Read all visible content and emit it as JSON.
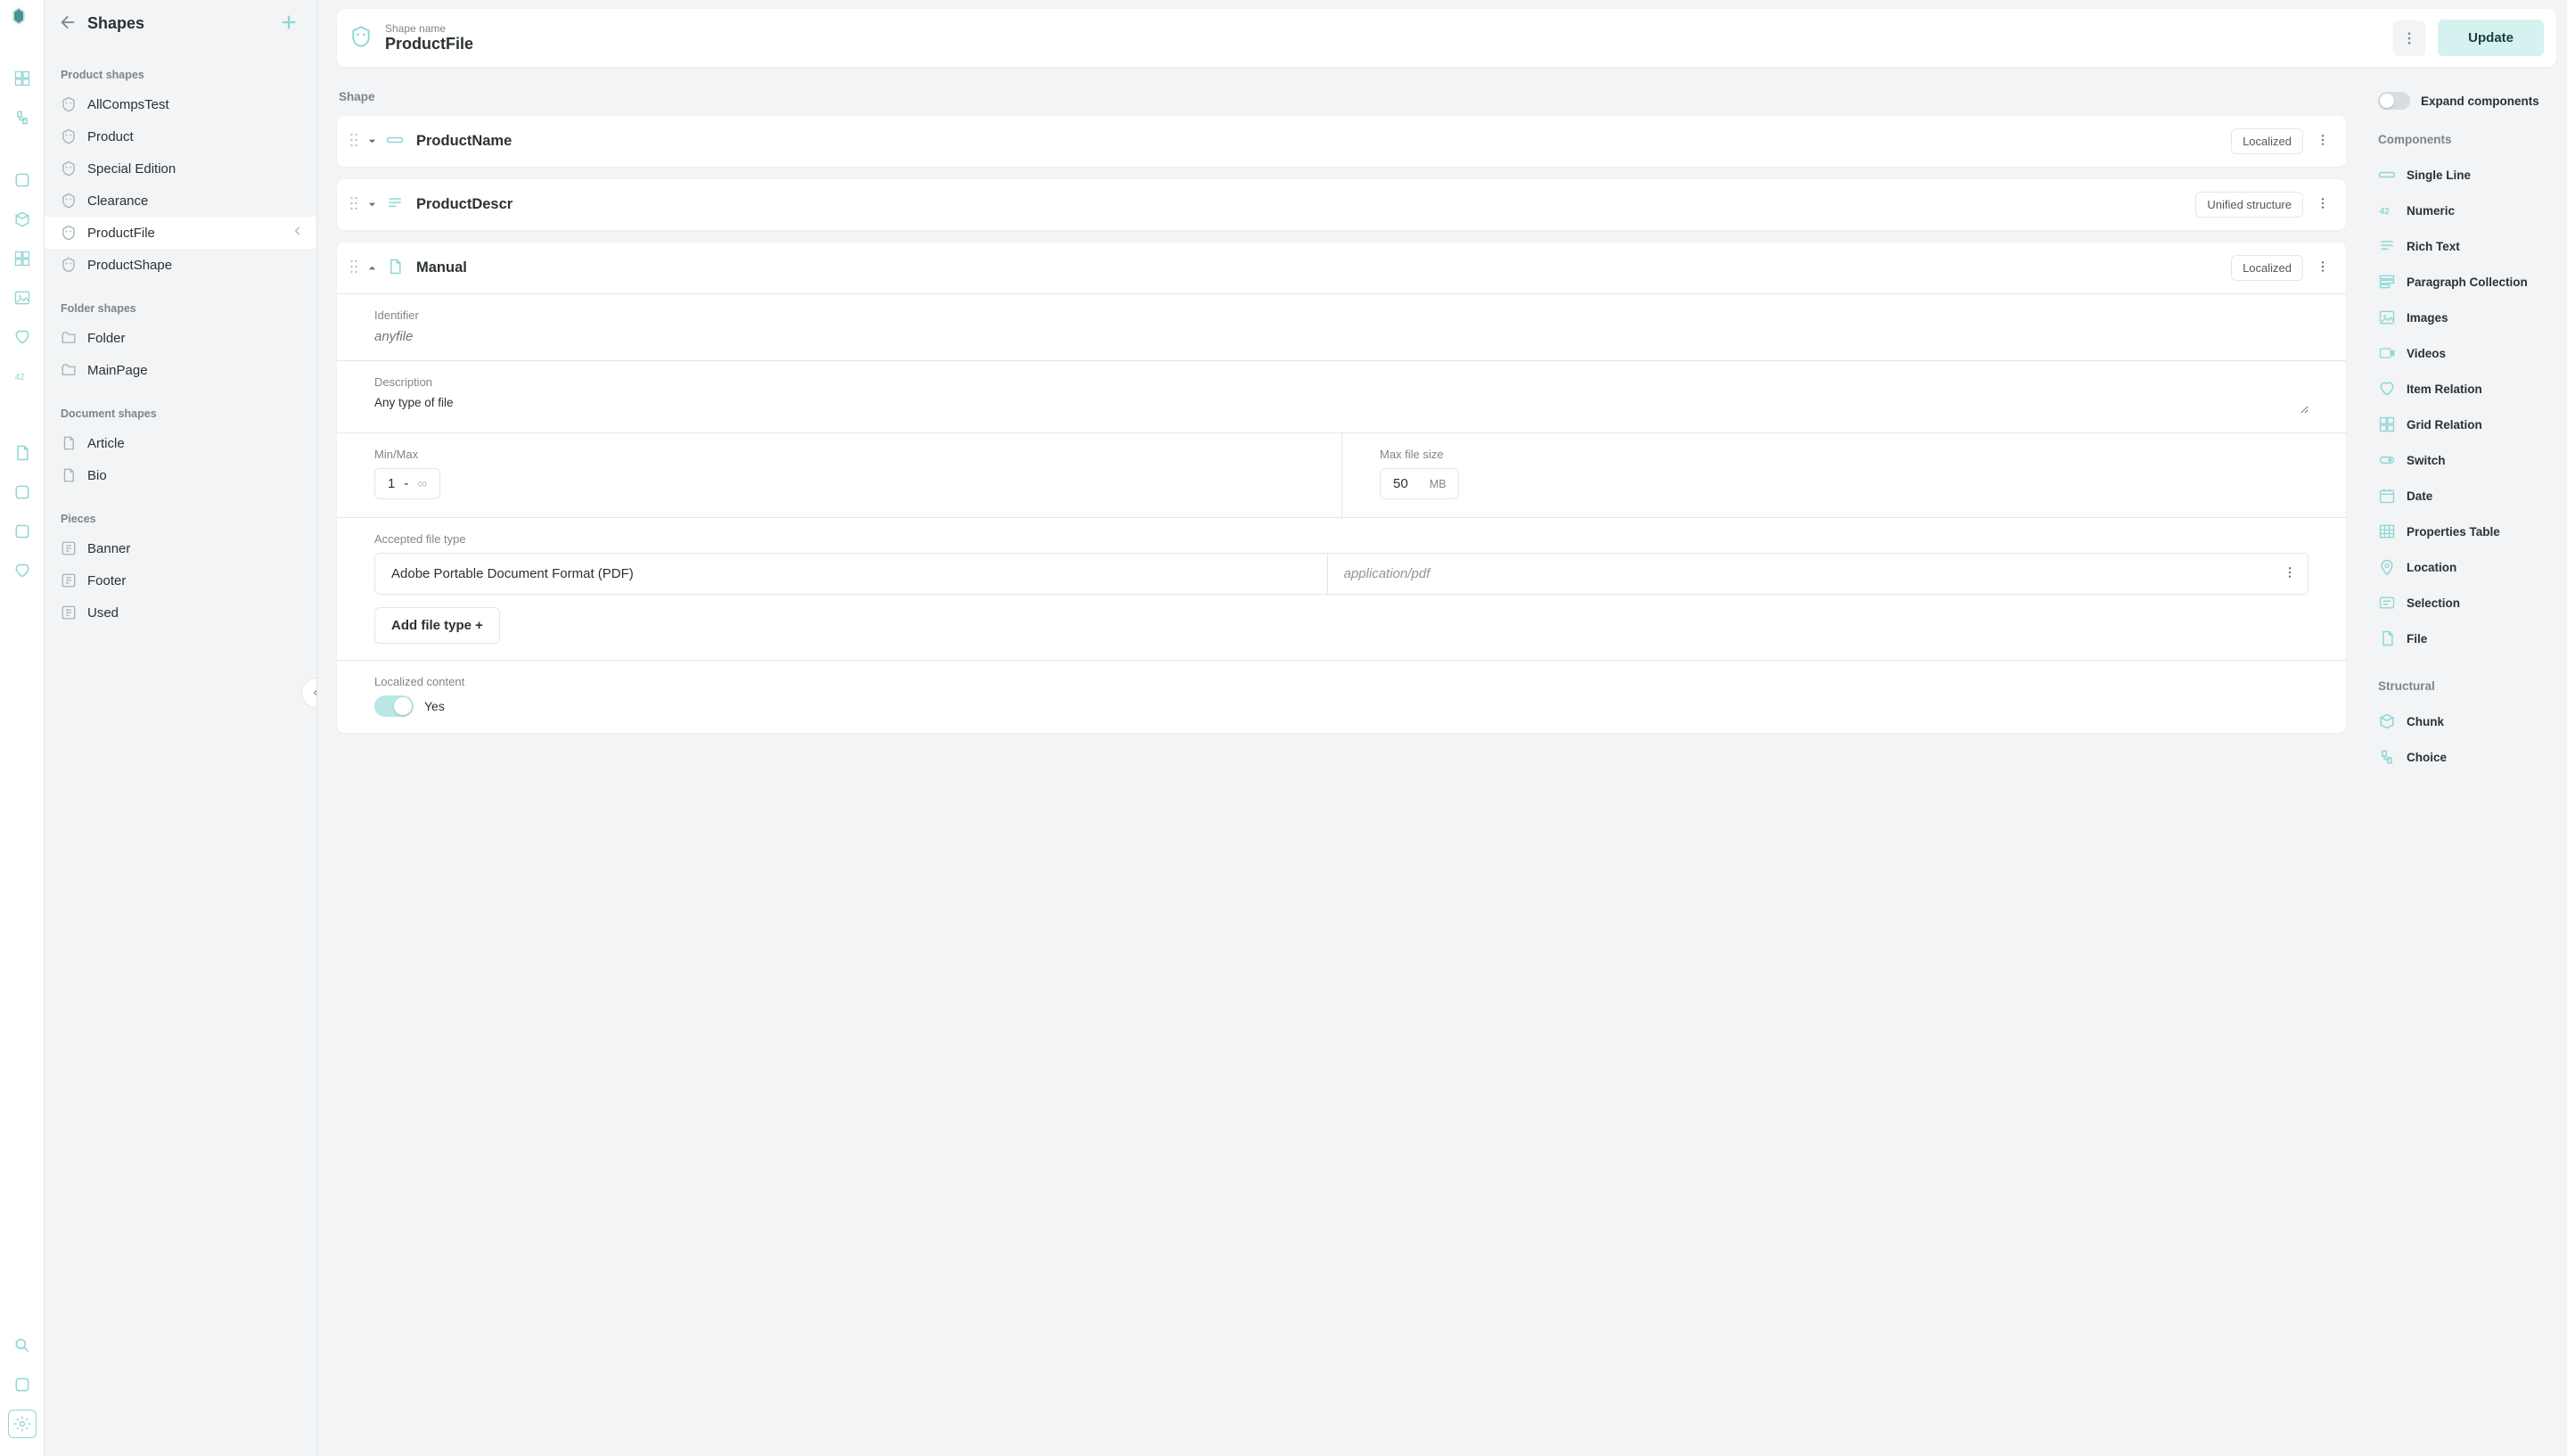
{
  "sidebar": {
    "title": "Shapes",
    "groups": [
      {
        "title": "Product shapes",
        "items": [
          {
            "label": "AllCompsTest",
            "active": false
          },
          {
            "label": "Product",
            "active": false
          },
          {
            "label": "Special Edition",
            "active": false
          },
          {
            "label": "Clearance",
            "active": false
          },
          {
            "label": "ProductFile",
            "active": true
          },
          {
            "label": "ProductShape",
            "active": false
          }
        ]
      },
      {
        "title": "Folder shapes",
        "items": [
          {
            "label": "Folder"
          },
          {
            "label": "MainPage"
          }
        ]
      },
      {
        "title": "Document shapes",
        "items": [
          {
            "label": "Article"
          },
          {
            "label": "Bio"
          }
        ]
      },
      {
        "title": "Pieces",
        "items": [
          {
            "label": "Banner"
          },
          {
            "label": "Footer"
          },
          {
            "label": "Used"
          }
        ]
      }
    ]
  },
  "header": {
    "label": "Shape name",
    "value": "ProductFile",
    "update_label": "Update"
  },
  "editor": {
    "section_label": "Shape",
    "components": [
      {
        "name": "ProductName",
        "tag": "Localized",
        "expanded": false,
        "type": "single-line"
      },
      {
        "name": "ProductDescr",
        "tag": "Unified structure",
        "expanded": false,
        "type": "rich-text"
      },
      {
        "name": "Manual",
        "tag": "Localized",
        "expanded": true,
        "type": "file",
        "identifier_label": "Identifier",
        "identifier": "anyfile",
        "description_label": "Description",
        "description": "Any type of file",
        "minmax_label": "Min/Max",
        "min": "1",
        "dash": "-",
        "max_placeholder": "∞",
        "maxfs_label": "Max file size",
        "maxfs": "50",
        "maxfs_unit": "MB",
        "aft_label": "Accepted file type",
        "ft_name": "Adobe Portable Document Format (PDF)",
        "ft_mime": "application/pdf",
        "add_ft_label": "Add file type +",
        "loc_label": "Localized content",
        "loc_value": "Yes"
      }
    ]
  },
  "inspector": {
    "expand_label": "Expand components",
    "sections": [
      {
        "title": "Components",
        "items": [
          "Single Line",
          "Numeric",
          "Rich Text",
          "Paragraph Collection",
          "Images",
          "Videos",
          "Item Relation",
          "Grid Relation",
          "Switch",
          "Date",
          "Properties Table",
          "Location",
          "Selection",
          "File"
        ]
      },
      {
        "title": "Structural",
        "items": [
          "Chunk",
          "Choice"
        ]
      }
    ]
  }
}
